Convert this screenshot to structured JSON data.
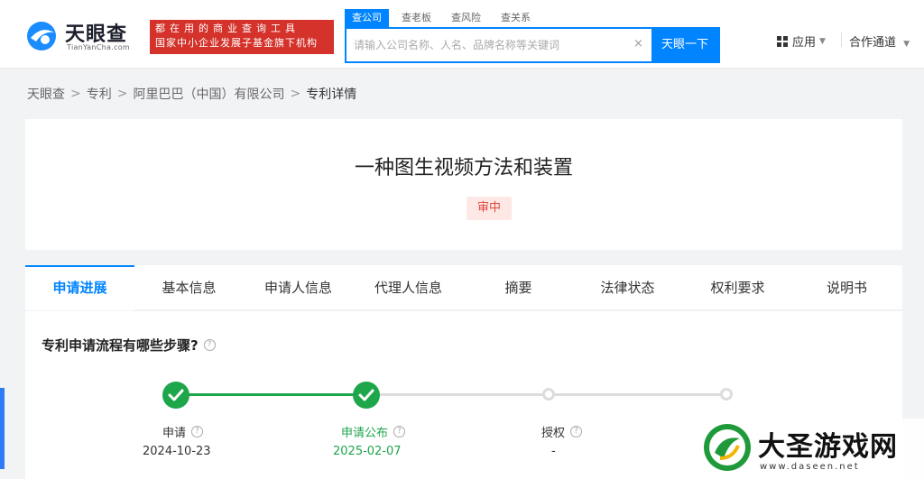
{
  "header": {
    "logo_text": "天眼查",
    "logo_en": "TianYanCha.com",
    "slogan_line1": "都在用的商业查询工具",
    "slogan_line2": "国家中小企业发展子基金旗下机构",
    "search_tabs": [
      "查公司",
      "查老板",
      "查风险",
      "查关系"
    ],
    "search_placeholder": "请输入公司名称、人名、品牌名称等关键词",
    "search_clear": "×",
    "search_button": "天眼一下",
    "nav_apps": "应用",
    "nav_partner": "合作通道"
  },
  "breadcrumb": {
    "items": [
      "天眼查",
      "专利",
      "阿里巴巴（中国）有限公司",
      "专利详情"
    ],
    "separator": ">"
  },
  "patent": {
    "title": "一种图生视频方法和装置",
    "status": "审中"
  },
  "tabs": [
    "申请进展",
    "基本信息",
    "申请人信息",
    "代理人信息",
    "摘要",
    "法律状态",
    "权利要求",
    "说明书"
  ],
  "progress": {
    "section_title": "专利申请流程有哪些步骤?",
    "steps": [
      {
        "label": "申请",
        "date": "2024-10-23",
        "done": true
      },
      {
        "label": "申请公布",
        "date": "2025-02-07",
        "done": true
      },
      {
        "label": "授权",
        "date": "-",
        "done": false
      },
      {
        "label": "",
        "date": "",
        "done": false
      }
    ]
  },
  "watermark": {
    "name": "大圣游戏网",
    "url": "www.daseen.net"
  },
  "colors": {
    "primary": "#0084ff",
    "done": "#1ea64b",
    "status": "#e0493c",
    "slogan_bg": "#d4322b"
  }
}
